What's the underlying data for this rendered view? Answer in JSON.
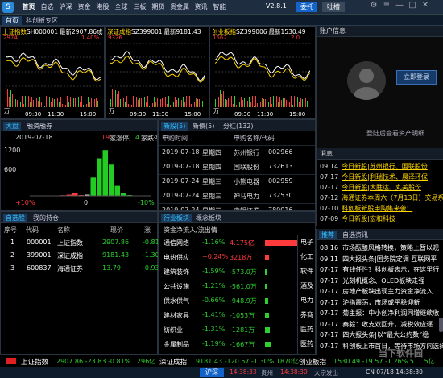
{
  "topbar": {
    "logo": "S",
    "menu": [
      "首页",
      "自选",
      "沪深",
      "资金",
      "港股",
      "全球",
      "三板",
      "期货",
      "贵金属",
      "资讯",
      "智能"
    ],
    "version": "V2.8.1",
    "btn1": "委托",
    "btn2": "吐槽"
  },
  "subtabs": [
    "首页",
    "科创板专区"
  ],
  "indices": [
    {
      "name": "上证指数",
      "code": "SH000001",
      "price": "最新2907.86",
      "extra": "成",
      "volmax": "2974",
      "pct_left": "1.40%",
      "time_labels": [
        "09:30",
        "11:30",
        "15:00"
      ],
      "vol_unit": "万",
      "vol_top": "2",
      "vol_mid": "3",
      "vol_low": "1"
    },
    {
      "name": "深证成指",
      "code": "SZ399001",
      "price": "最新9181.43",
      "extra": "",
      "volmax": "9326",
      "pct_left": "",
      "time_labels": [
        "09:30",
        "11:30",
        "15:00"
      ],
      "vol_unit": "万",
      "vol_top": "5",
      "vol_mid": "3",
      "vol_low": "1"
    },
    {
      "name": "创业板指",
      "code": "SZ399006",
      "price": "最新1530.49",
      "extra": "",
      "volmax": "1562",
      "pct_left": "2.0",
      "time_labels": [
        "09:30",
        "11:30",
        "15:00"
      ],
      "vol_unit": "万",
      "vol_top": "1",
      "vol_mid": "1",
      "vol_low": "1"
    }
  ],
  "market": {
    "tabs": [
      "大盘",
      "融资融券"
    ],
    "date": "2019-07-18",
    "up_count": "19",
    "up_text": "家涨停,",
    "down_count": "4",
    "down_text": "家跌停",
    "y_labels": [
      "1200",
      "600"
    ],
    "x_labels": [
      "+10%",
      "0",
      "-10%"
    ],
    "bars": [
      {
        "v": 0,
        "c": "#ff3b3b"
      },
      {
        "v": 0,
        "c": "#ff3b3b"
      },
      {
        "v": 0,
        "c": "#ff3b3b"
      },
      {
        "v": 0,
        "c": "#ff3b3b"
      },
      {
        "v": 5,
        "c": "#ff3b3b"
      },
      {
        "v": 15,
        "c": "#ff3b3b"
      },
      {
        "v": 30,
        "c": "#ff3b3b"
      },
      {
        "v": 60,
        "c": "#ff3b3b"
      },
      {
        "v": 20,
        "c": "#ff3b3b"
      },
      {
        "v": 30,
        "c": "#dddddd"
      },
      {
        "v": 440,
        "c": "#22cc22"
      },
      {
        "v": 900,
        "c": "#22cc22"
      },
      {
        "v": 1100,
        "c": "#22cc22"
      },
      {
        "v": 750,
        "c": "#22cc22"
      },
      {
        "v": 240,
        "c": "#22cc22"
      },
      {
        "v": 60,
        "c": "#22cc22"
      },
      {
        "v": 20,
        "c": "#22cc22"
      },
      {
        "v": 5,
        "c": "#22cc22"
      },
      {
        "v": 0,
        "c": "#22cc22"
      },
      {
        "v": 0,
        "c": "#22cc22"
      }
    ]
  },
  "ipo": {
    "tabs": [
      "新股(5)",
      "新债(5)",
      "分红(132)"
    ],
    "headers": [
      "申购时间",
      "申购名称/代码"
    ],
    "rows": [
      {
        "date": "2019-07-18",
        "day": "星期四",
        "name": "苏州银行",
        "code": "002966"
      },
      {
        "date": "2019-07-18",
        "day": "星期四",
        "name": "国联股份",
        "code": "732613"
      },
      {
        "date": "2019-07-24",
        "day": "星期三",
        "name": "小熊电器",
        "code": "002959"
      },
      {
        "date": "2019-07-24",
        "day": "星期三",
        "name": "神马电力",
        "code": "732530"
      },
      {
        "date": "2019-07-24",
        "day": "星期三",
        "name": "中银证券",
        "code": "780016"
      }
    ]
  },
  "account": {
    "title": "账户信息",
    "login_btn": "立即登录",
    "login_link": "登陆后查看资产明细"
  },
  "news": {
    "title": "消息",
    "items": [
      {
        "time": "09:14",
        "text": "今日新股|苏州银行、国联股份"
      },
      {
        "time": "07-17",
        "text": "今日新股|利瑞技术、晨泽环保"
      },
      {
        "time": "07-17",
        "text": "今日新股|大胜达、丸美股份"
      },
      {
        "time": "07-12",
        "text": "海通证券本周六（7月13日）交易系统"
      },
      {
        "time": "07-10",
        "text": "科创板新股申购集来袭！"
      },
      {
        "time": "07-09",
        "text": "今日新股|宏和科技"
      }
    ]
  },
  "watch": {
    "tabs": [
      "自选股",
      "我的持仓"
    ],
    "headers": [
      "序号",
      "代码",
      "名称",
      "现价",
      "涨"
    ],
    "rows": [
      {
        "no": "1",
        "code": "000001",
        "name": "上证指数",
        "price": "2907.86",
        "chg": "-0.81"
      },
      {
        "no": "2",
        "code": "399001",
        "name": "深证成指",
        "price": "9181.43",
        "chg": "-1.30"
      },
      {
        "no": "3",
        "code": "600837",
        "name": "海通证券",
        "price": "13.79",
        "chg": "-0.93"
      }
    ]
  },
  "sector": {
    "tabs": [
      "行业板块",
      "概念板块"
    ],
    "subtitle": "资金净流入/流出情",
    "rows": [
      {
        "name": "通信网络",
        "pct": "-1.16%",
        "flow": "4.175亿",
        "color": "red",
        "bar": 40
      },
      {
        "name": "电热供应",
        "pct": "+0.24%",
        "flow": "3218万",
        "color": "red",
        "bar": 5
      },
      {
        "name": "建筑装饰",
        "pct": "-1.59%",
        "flow": "-573.0万",
        "color": "green",
        "bar": 3
      },
      {
        "name": "公共设施",
        "pct": "-1.21%",
        "flow": "-561.0万",
        "color": "green",
        "bar": 3
      },
      {
        "name": "供水供气",
        "pct": "-0.66%",
        "flow": "-948.9万",
        "color": "green",
        "bar": 4
      },
      {
        "name": "建材家具",
        "pct": "-1.41%",
        "flow": "-1053万",
        "color": "green",
        "bar": 5
      },
      {
        "name": "纺织业",
        "pct": "-1.31%",
        "flow": "-1281万",
        "color": "green",
        "bar": 6
      },
      {
        "name": "金属制品",
        "pct": "-1.19%",
        "flow": "-1667万",
        "color": "green",
        "bar": 7
      }
    ],
    "right_labels": [
      "电子",
      "化工",
      "软件",
      "酒及",
      "电力",
      "券商",
      "医药",
      "医药"
    ]
  },
  "infonews": {
    "tabs": [
      "推荐",
      "自选资讯"
    ],
    "items": [
      {
        "time": "08:16",
        "text": "市场酝酿风格转换，策略上暂以观"
      },
      {
        "time": "09:11",
        "text": "四大报头条|国务院定调 互联网平"
      },
      {
        "time": "07-17",
        "text": "有钱任性？科创板表示，在这里行"
      },
      {
        "time": "07-17",
        "text": "光刻机概念、OLED板块走强"
      },
      {
        "time": "07-17",
        "text": "房地产板块出现主力资金净流入"
      },
      {
        "time": "07-17",
        "text": "沪指震荡，市场或平稳迎新"
      },
      {
        "time": "07-17",
        "text": "菊主报：中小创净利润同增继续收"
      },
      {
        "time": "07-17",
        "text": "秦毅：收支双回升，减税效应逐"
      },
      {
        "time": "07-17",
        "text": "四大报头条|以“最大公约数”稳"
      },
      {
        "time": "07-17",
        "text": "科创板上市首日，等待市场方向选择"
      }
    ]
  },
  "statusbar": {
    "items": [
      {
        "name": "上证指数",
        "vals": "2907.86 -23.83 -0.81% 1296亿"
      },
      {
        "name": "深证成指",
        "vals": "9181.43 -120.57 -1.30% 1870亿"
      },
      {
        "name": "创业板指",
        "vals": "1530.49 -19.57 -1.26% 511.5亿"
      }
    ]
  },
  "bottombar": {
    "btn": "沪深",
    "time1": "14:38:33",
    "city": "贵州",
    "time2": "14:38:30",
    "label": "大宗发出",
    "date": "CN 07/18 14:38:30"
  },
  "watermark": "当下软件园"
}
